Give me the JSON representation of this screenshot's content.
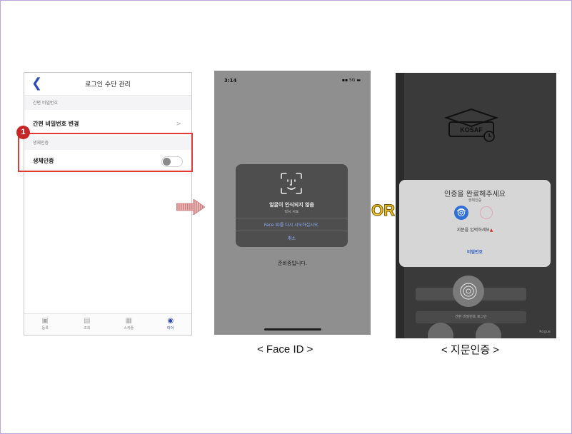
{
  "settings_screen": {
    "title": "로그인 수단 관리",
    "back_icon": "chevron-left-icon",
    "section_simple_pw": "간편 비밀번호",
    "row_change_pw": "간편 비밀번호 변경",
    "row_change_pw_chevron": ">",
    "section_biometric": "생체인증",
    "row_biometric": "생체인증",
    "biometric_enabled": false,
    "step_marker": "1",
    "tabs": [
      {
        "label": "등록",
        "icon": "document-icon"
      },
      {
        "label": "조회",
        "icon": "search-doc-icon"
      },
      {
        "label": "스케줄",
        "icon": "calendar-icon"
      },
      {
        "label": "마이",
        "icon": "user-icon",
        "active": true
      }
    ]
  },
  "faceid_screen": {
    "time": "3:14",
    "network": "5G",
    "dialog_message": "얼굴이 인식되지 않음",
    "dialog_sub": "다시 시도",
    "retry_label": "Face ID를 다시 시도하십시오.",
    "cancel_label": "취소",
    "status_text": "준비중입니다.",
    "caption": "< Face ID >"
  },
  "or_label": "OR",
  "fingerprint_screen": {
    "logo_text": "KOSAF",
    "dialog_title": "인증을 완료해주세요",
    "dialog_sub": "생체인증",
    "instruction": "지문을 입력하세요",
    "password_label": "비밀번호",
    "bottom_bar_label": "간편 비밀번호 로그인",
    "brand": "Rogue",
    "caption": "< 지문인증 >"
  },
  "colors": {
    "accent_blue": "#2c4ab8",
    "highlight_red": "#e53935",
    "or_yellow": "#f2c321"
  }
}
